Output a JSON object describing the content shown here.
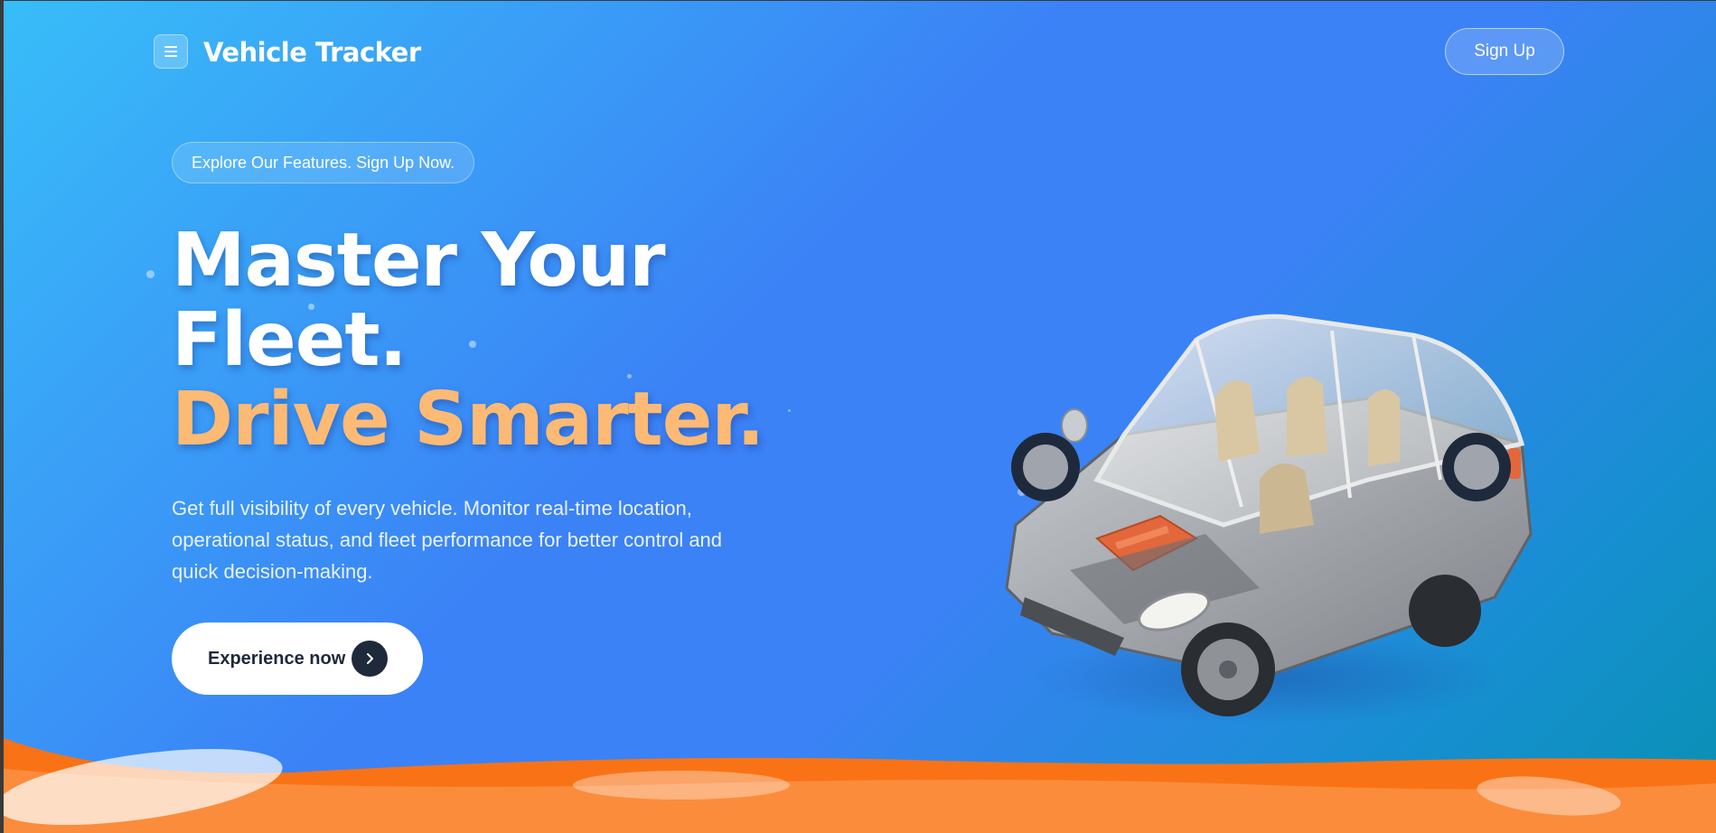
{
  "header": {
    "menu_icon": "hamburger-menu-icon",
    "brand": "Vehicle Tracker",
    "signup_label": "Sign Up"
  },
  "hero": {
    "badge": "Explore Our Features. Sign Up Now.",
    "headline_line1": "Master Your",
    "headline_line2": "Fleet.",
    "headline_accent": "Drive Smarter.",
    "description": "Get full visibility of every vehicle. Monitor real-time location, operational status, and fleet performance for better control and quick decision-making.",
    "cta_label": "Experience now",
    "cta_icon": "chevron-right-icon",
    "illustration": "transparent-car-illustration"
  },
  "colors": {
    "gradient_start": "#38bdf8",
    "gradient_mid": "#3b82f6",
    "gradient_end": "#0891b2",
    "accent_orange": "#fdba74",
    "wave_orange": "#f97316",
    "cta_dark": "#1e293b"
  }
}
